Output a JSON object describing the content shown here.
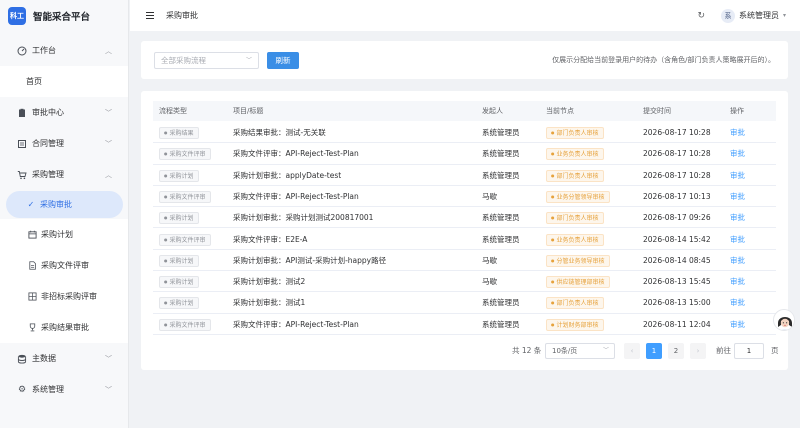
{
  "app": {
    "logo_badge": "科工",
    "title": "智能采合平台"
  },
  "sidebar": {
    "items": [
      {
        "label": "工作台",
        "icon": "dashboard-icon"
      },
      {
        "label": "首页"
      },
      {
        "label": "审批中心",
        "icon": "clipboard-icon"
      },
      {
        "label": "合同管理",
        "icon": "contract-icon"
      },
      {
        "label": "采购管理",
        "icon": "cart-icon"
      },
      {
        "label": "采购审批",
        "icon": "check-icon"
      },
      {
        "label": "采购计划",
        "icon": "calendar-icon"
      },
      {
        "label": "采购文件评审",
        "icon": "document-icon"
      },
      {
        "label": "非招标采购评审",
        "icon": "grid-icon"
      },
      {
        "label": "采购结果审批",
        "icon": "trophy-icon"
      },
      {
        "label": "主数据",
        "icon": "database-icon"
      },
      {
        "label": "系统管理",
        "icon": "gear-icon"
      }
    ]
  },
  "header": {
    "breadcrumb": "采购审批",
    "user_avatar": "系",
    "user_name": "系统管理员"
  },
  "filter": {
    "select_placeholder": "全部采购流程",
    "refresh_label": "刷新",
    "tip": "仅展示分配给当前登录用户的待办（含角色/部门负责人策略展开后的）。"
  },
  "table": {
    "columns": [
      "流程类型",
      "项目/标题",
      "发起人",
      "当前节点",
      "提交时间",
      "操作"
    ],
    "rows": [
      {
        "type": "采购结果",
        "title": "采购结果审批：测试-无关联",
        "initiator": "系统管理员",
        "node": "部门负责人审核",
        "time": "2026-08-17 10:28",
        "action": "审批"
      },
      {
        "type": "采购文件评审",
        "title": "采购文件评审：API-Reject-Test-Plan",
        "initiator": "系统管理员",
        "node": "业务负责人审核",
        "time": "2026-08-17 10:28",
        "action": "审批"
      },
      {
        "type": "采购计划",
        "title": "采购计划审批：applyDate-test",
        "initiator": "系统管理员",
        "node": "部门负责人审核",
        "time": "2026-08-17 10:28",
        "action": "审批"
      },
      {
        "type": "采购文件评审",
        "title": "采购文件评审：API-Reject-Test-Plan",
        "initiator": "马歇",
        "node": "业务分管领导审核",
        "time": "2026-08-17 10:13",
        "action": "审批"
      },
      {
        "type": "采购计划",
        "title": "采购计划审批：采购计划测试200817001",
        "initiator": "系统管理员",
        "node": "部门负责人审核",
        "time": "2026-08-17 09:26",
        "action": "审批"
      },
      {
        "type": "采购文件评审",
        "title": "采购文件评审：E2E-A",
        "initiator": "系统管理员",
        "node": "业务负责人审核",
        "time": "2026-08-14 15:42",
        "action": "审批"
      },
      {
        "type": "采购计划",
        "title": "采购计划审批：API测试-采购计划-happy路径",
        "initiator": "马歇",
        "node": "分管业务领导审核",
        "time": "2026-08-14 08:45",
        "action": "审批"
      },
      {
        "type": "采购计划",
        "title": "采购计划审批：测试2",
        "initiator": "马歇",
        "node": "供应链管理部审核",
        "time": "2026-08-13 15:45",
        "action": "审批"
      },
      {
        "type": "采购计划",
        "title": "采购计划审批：测试1",
        "initiator": "系统管理员",
        "node": "部门负责人审核",
        "time": "2026-08-13 15:00",
        "action": "审批"
      },
      {
        "type": "采购文件评审",
        "title": "采购文件评审：API-Reject-Test-Plan",
        "initiator": "系统管理员",
        "node": "计划财务部审核",
        "time": "2026-08-11 12:04",
        "action": "审批"
      }
    ]
  },
  "pagination": {
    "total_text": "共 12 条",
    "page_size": "10条/页",
    "pages": [
      "1",
      "2"
    ],
    "current_page": "1",
    "goto_label": "前往",
    "goto_value": "1",
    "goto_unit": "页"
  }
}
